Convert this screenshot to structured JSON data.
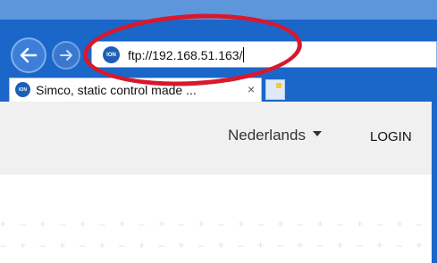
{
  "browser": {
    "address_bar": {
      "favicon_text": "ION",
      "url": "ftp://192.168.51.163/"
    },
    "tab": {
      "favicon_text": "ION",
      "title": "Simco, static control made ...",
      "close_glyph": "×"
    },
    "icons": {
      "back": "arrow-left-icon",
      "forward": "arrow-right-icon"
    }
  },
  "site_header": {
    "language": "Nederlands",
    "login": "LOGIN"
  },
  "colors": {
    "chrome": "#1b66c9",
    "highlight": "#d9182b",
    "header_bg": "#f0f0f0"
  }
}
